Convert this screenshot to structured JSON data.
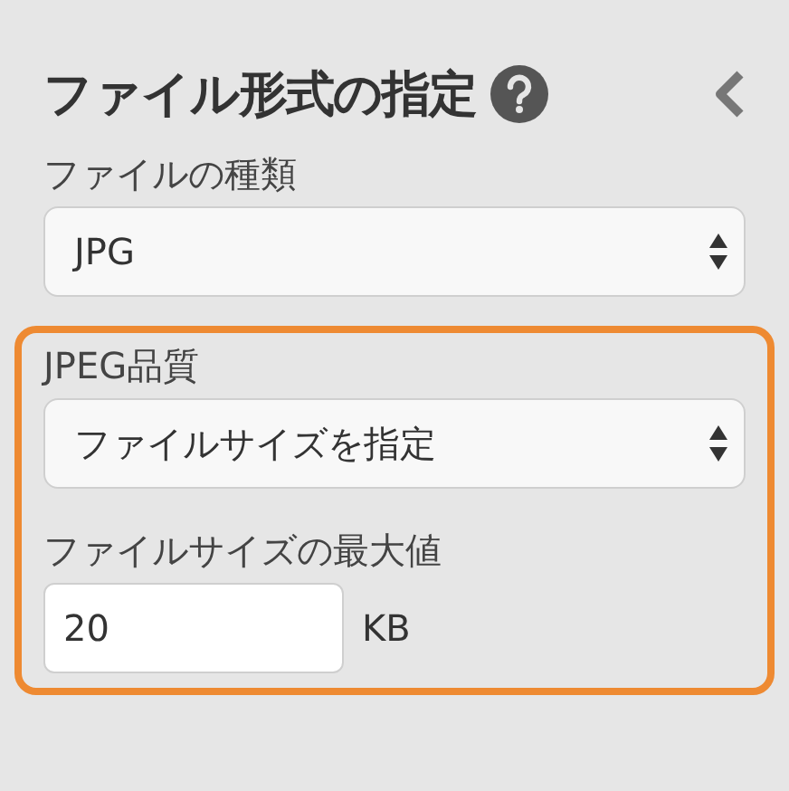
{
  "panel": {
    "title": "ファイル形式の指定"
  },
  "file_type": {
    "label": "ファイルの種類",
    "value": "JPG"
  },
  "quality_group": {
    "highlighted": true,
    "label": "JPEG品質",
    "value": "ファイルサイズを指定",
    "max_size": {
      "label": "ファイルサイズの最大値",
      "value": "20",
      "unit": "KB"
    }
  }
}
